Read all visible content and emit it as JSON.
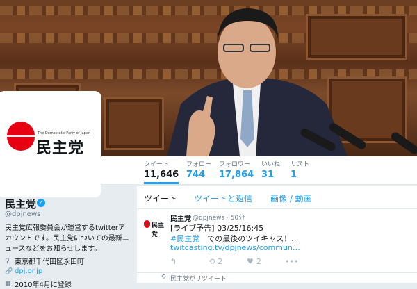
{
  "profile": {
    "display_name": "民主党",
    "handle": "@dpjnews",
    "bio": "民主党広報委員会が運営するtwitterアカウントです。民主党についての最新ニュースなどをお知らせします。",
    "location": "東京都千代田区永田町",
    "website": "dpj.or.jp",
    "joined": "2010年4月に登録",
    "avatar_tagline": "The Democratic Party of Japan",
    "avatar_logo": "民主党"
  },
  "stats": [
    {
      "label": "ツイート",
      "value": "11,646"
    },
    {
      "label": "フォロー",
      "value": "744"
    },
    {
      "label": "フォロワー",
      "value": "17,864"
    },
    {
      "label": "いいね",
      "value": "31"
    },
    {
      "label": "リスト",
      "value": "1"
    }
  ],
  "tabs": [
    "ツイート",
    "ツイートと返信",
    "画像 / 動画"
  ],
  "tweet": {
    "avatar_text": "民主党",
    "name": "民主党",
    "handle_time": "@dpjnews · 50分",
    "line1": "[ライブ予告] 03/25/16:45",
    "hashtag": "#民主党",
    "line2_rest": "　での最後のツイキャス！..",
    "link": "twitcasting.tv/dpjnews/commun…",
    "reply_icon": "reply-icon",
    "retweet_count": "2",
    "like_count": "2",
    "retweeted_by": "民主党がリツイート"
  },
  "colors": {
    "accent": "#1da1f2",
    "party_red": "#e60012"
  }
}
